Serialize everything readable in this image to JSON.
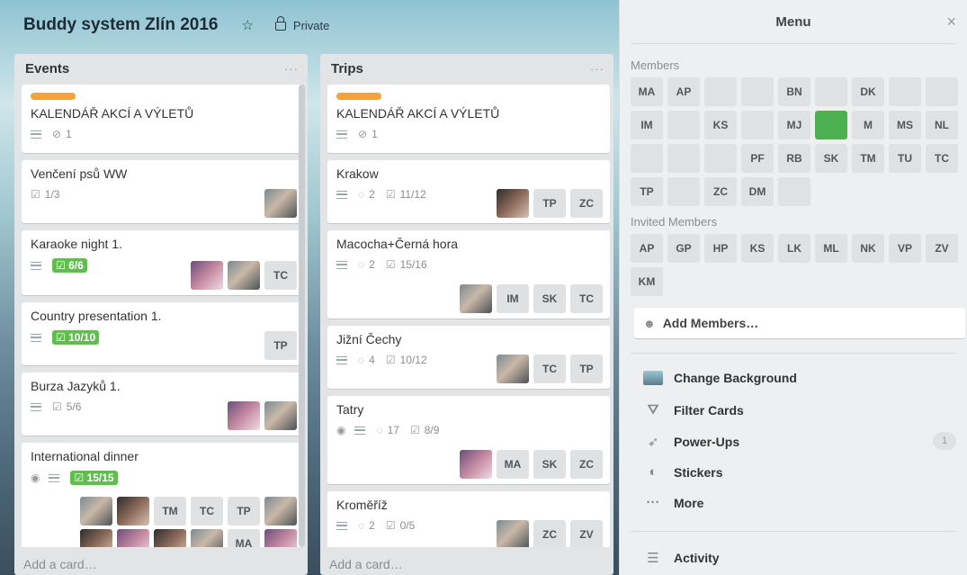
{
  "board": {
    "title": "Buddy system Zlín 2016",
    "visibility": "Private"
  },
  "lists": [
    {
      "title": "Events",
      "menu": "···",
      "add_card": "Add a card…",
      "cards": [
        {
          "title": "KALENDÁŘ AKCÍ A VÝLETŮ",
          "label": true,
          "attachments": "1"
        },
        {
          "title": "Venčení psů WW",
          "checklist": "1/3",
          "members": [
            "photo"
          ]
        },
        {
          "title": "Karaoke night 1.",
          "checklist_done": "6/6",
          "members": [
            "photo",
            "photo",
            "TC"
          ]
        },
        {
          "title": "Country presentation 1.",
          "checklist_done": "10/10",
          "members": [
            "TP"
          ]
        },
        {
          "title": "Burza Jazyků 1.",
          "checklist": "5/6",
          "members": [
            "photo",
            "photo"
          ]
        },
        {
          "title": "International dinner",
          "checklist_done": "15/15",
          "members": [
            "photo",
            "photo",
            "TM",
            "TC",
            "TP",
            "photo"
          ],
          "members2": [
            "photo",
            "photo",
            "photo",
            "photo",
            "MA",
            "photo"
          ]
        }
      ]
    },
    {
      "title": "Trips",
      "menu": "···",
      "add_card": "Add a card…",
      "cards": [
        {
          "title": "KALENDÁŘ AKCÍ A VÝLETŮ",
          "label": true,
          "attachments": "1"
        },
        {
          "title": "Krakow",
          "comments": "2",
          "checklist": "11/12",
          "members": [
            "photo",
            "TP",
            "ZC"
          ]
        },
        {
          "title": "Macocha+Černá hora",
          "comments": "2",
          "checklist": "15/16",
          "members": [
            "photo",
            "IM",
            "SK",
            "TC"
          ]
        },
        {
          "title": "Jižní Čechy",
          "comments": "4",
          "checklist": "10/12",
          "members": [
            "photo",
            "TC",
            "TP"
          ]
        },
        {
          "title": "Tatry",
          "comments": "17",
          "checklist": "8/9",
          "members": [
            "photo",
            "MA",
            "SK",
            "ZC"
          ]
        },
        {
          "title": "Kroměříž",
          "comments": "2",
          "checklist": "0/5",
          "members": [
            "photo",
            "ZC",
            "ZV"
          ]
        }
      ]
    }
  ],
  "menu": {
    "title": "Menu",
    "close": "×",
    "members_label": "Members",
    "members": [
      "MA",
      "AP",
      "photo",
      "photo",
      "BN",
      "photo",
      "DK",
      "photo",
      "photo",
      "IM",
      "photo",
      "KS",
      "photo",
      "MJ",
      "photo",
      "M",
      "MS",
      "NL",
      "photo",
      "photo",
      "photo",
      "PF",
      "RB",
      "SK",
      "TM",
      "TU",
      "TC",
      "TP",
      "photo",
      "ZC",
      "DM",
      "photo"
    ],
    "invited_label": "Invited Members",
    "invited": [
      "AP",
      "GP",
      "HP",
      "KS",
      "LK",
      "ML",
      "NK",
      "VP",
      "ZV",
      "KM"
    ],
    "add_members": "Add Members…",
    "items": [
      {
        "label": "Change Background",
        "icon": "background-thumbnail-icon"
      },
      {
        "label": "Filter Cards",
        "icon": "filter-icon"
      },
      {
        "label": "Power-Ups",
        "icon": "rocket-icon",
        "count": "1"
      },
      {
        "label": "Stickers",
        "icon": "sticker-icon"
      },
      {
        "label": "More",
        "icon": "ellipsis-icon"
      }
    ],
    "activity": "Activity"
  },
  "colors": {
    "label_orange": "#f6a23a",
    "checklist_green": "#61bd4f"
  }
}
